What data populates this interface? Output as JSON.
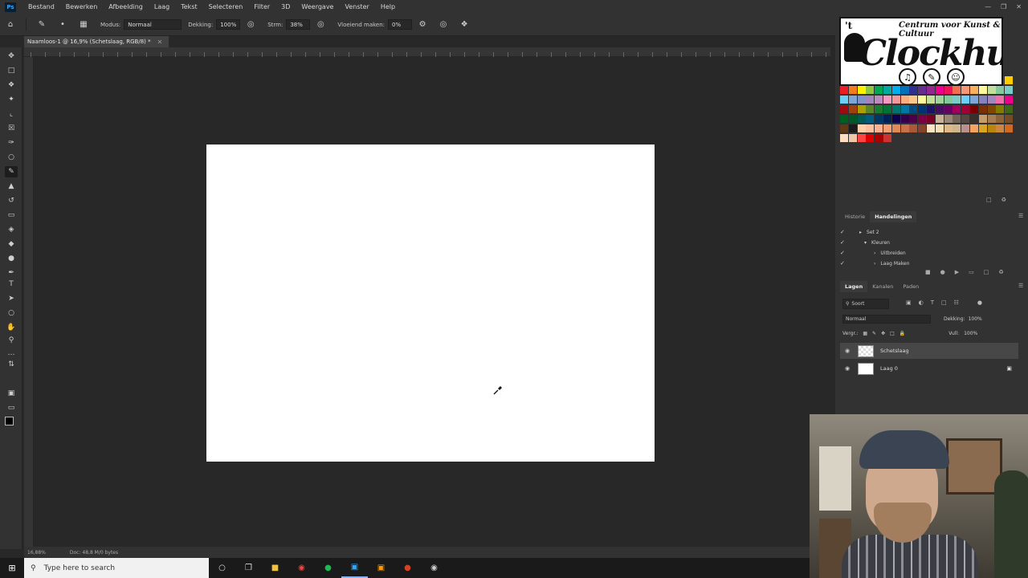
{
  "app": {
    "logo_text": "Ps",
    "menu": [
      "Bestand",
      "Bewerken",
      "Afbeelding",
      "Laag",
      "Tekst",
      "Selecteren",
      "Filter",
      "3D",
      "Weergave",
      "Venster",
      "Help"
    ]
  },
  "options_bar": {
    "mode_label": "Modus:",
    "mode_value": "Normaal",
    "opacity_label": "Dekking:",
    "opacity_value": "100%",
    "flow_label": "Strm:",
    "flow_value": "38%",
    "smoothing_label": "Vloeiend maken:",
    "smoothing_value": "0%"
  },
  "document": {
    "tab_title": "Naamloos-1 @ 16,9% (Schetslaag, RGB/8) *",
    "zoom_status": "16,88%",
    "doc_status": "Doc: 48,8 M/0 bytes",
    "canvas_color": "#ffffff"
  },
  "logo": {
    "t_mark": "'t",
    "top_line": "Centrum voor Kunst & Cultuur",
    "name": "Clockhuys"
  },
  "history_panel": {
    "tabs": [
      "Historie",
      "Handelingen"
    ],
    "active_tab": "Handelingen",
    "items": [
      {
        "label": "Set 2",
        "checked": true
      },
      {
        "label": "Kleuren",
        "checked": true
      },
      {
        "label": "Uitbreiden",
        "checked": true
      },
      {
        "label": "Laag Maken",
        "checked": true
      }
    ]
  },
  "layers_panel": {
    "tabs": [
      "Lagen",
      "Kanalen",
      "Paden"
    ],
    "active_tab": "Lagen",
    "filter_label": "Soort",
    "blend_mode": "Normaal",
    "opacity_label": "Dekking:",
    "opacity_value": "100%",
    "lock_label": "Vergr.:",
    "fill_label": "Vull:",
    "fill_value": "100%",
    "layers": [
      {
        "name": "Schetslaag",
        "selected": true,
        "transparent": true,
        "locked": false
      },
      {
        "name": "Laag 0",
        "selected": false,
        "transparent": false,
        "locked": true
      }
    ]
  },
  "taskbar": {
    "search_placeholder": "Type here to search"
  }
}
